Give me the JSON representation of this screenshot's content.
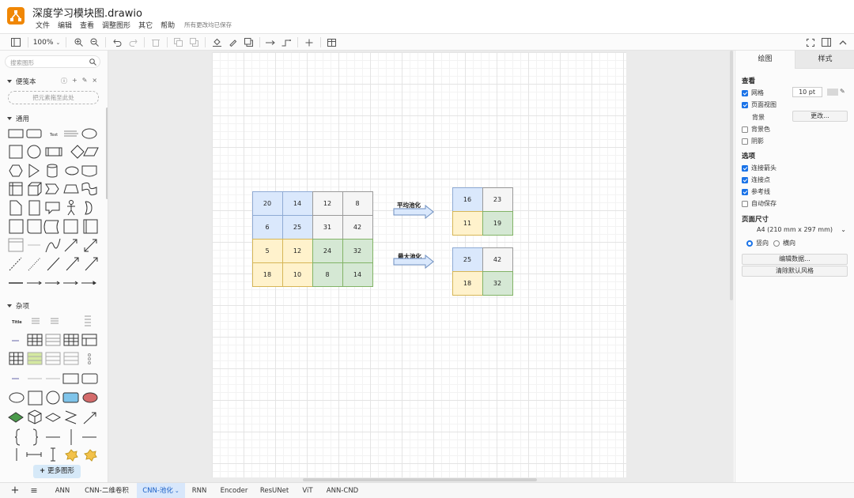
{
  "app": {
    "title": "深度学习模块图.drawio",
    "menu": [
      "文件",
      "编辑",
      "查看",
      "调整图形",
      "其它",
      "帮助"
    ],
    "save_status": "所有更改均已保存"
  },
  "toolbar": {
    "zoom": "100%"
  },
  "left_panel": {
    "search_placeholder": "搜索图形",
    "scratchpad_title": "便笺本",
    "scratchpad_drop": "把元素拖至此处",
    "general_title": "通用",
    "misc_title": "杂项",
    "shape_text": "Text",
    "misc_title_shape": "Title",
    "more_shapes": "更多图形"
  },
  "diagram": {
    "input_grid": [
      [
        {
          "v": "20",
          "c": "blue"
        },
        {
          "v": "14",
          "c": "blue"
        },
        {
          "v": "12",
          "c": "gray"
        },
        {
          "v": "8",
          "c": "gray"
        }
      ],
      [
        {
          "v": "6",
          "c": "blue"
        },
        {
          "v": "25",
          "c": "blue"
        },
        {
          "v": "31",
          "c": "gray"
        },
        {
          "v": "42",
          "c": "gray"
        }
      ],
      [
        {
          "v": "5",
          "c": "yellow"
        },
        {
          "v": "12",
          "c": "yellow"
        },
        {
          "v": "24",
          "c": "green"
        },
        {
          "v": "32",
          "c": "green"
        }
      ],
      [
        {
          "v": "18",
          "c": "yellow"
        },
        {
          "v": "10",
          "c": "yellow"
        },
        {
          "v": "8",
          "c": "green"
        },
        {
          "v": "14",
          "c": "green"
        }
      ]
    ],
    "avg_label": "平均池化",
    "max_label": "最大池化",
    "avg_grid": [
      [
        {
          "v": "16",
          "c": "blue"
        },
        {
          "v": "23",
          "c": "gray"
        }
      ],
      [
        {
          "v": "11",
          "c": "yellow"
        },
        {
          "v": "19",
          "c": "green"
        }
      ]
    ],
    "max_grid": [
      [
        {
          "v": "25",
          "c": "blue"
        },
        {
          "v": "42",
          "c": "gray"
        }
      ],
      [
        {
          "v": "18",
          "c": "yellow"
        },
        {
          "v": "32",
          "c": "green"
        }
      ]
    ],
    "colors": {
      "blue": "#dae8fc",
      "gray": "#f5f5f5",
      "yellow": "#fff2cc",
      "green": "#d5e8d4"
    }
  },
  "right_panel": {
    "tab_diagram": "绘图",
    "tab_style": "样式",
    "view_title": "查看",
    "grid_label": "网格",
    "grid_value": "10 pt",
    "page_view_label": "页面视图",
    "background_label": "背景",
    "change_button": "更改...",
    "bg_color_label": "背景色",
    "shadow_label": "阴影",
    "options_title": "选项",
    "connection_arrows": "连接箭头",
    "connection_points": "连接点",
    "guides": "参考线",
    "autosave": "自动保存",
    "page_size_title": "页面尺寸",
    "page_size_value": "A4 (210 mm x 297 mm)",
    "portrait": "竖向",
    "landscape": "横向",
    "edit_data": "编辑数据...",
    "clear_style": "清除默认风格"
  },
  "bottom_tabs": [
    "ANN",
    "CNN-二维卷积",
    "CNN-池化",
    "RNN",
    "Encoder",
    "ResUNet",
    "ViT",
    "ANN-CND"
  ],
  "active_tab": "CNN-池化"
}
